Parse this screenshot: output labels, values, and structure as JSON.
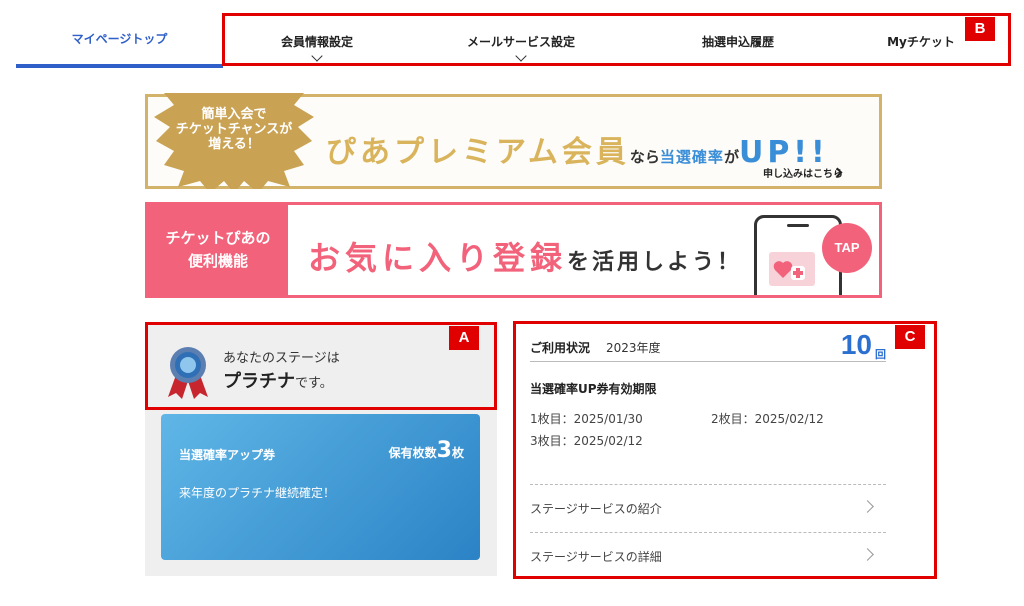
{
  "nav": {
    "home": "マイページトップ",
    "items": [
      {
        "label": "会員情報設定"
      },
      {
        "label": "メールサービス設定"
      },
      {
        "label": "抽選申込履歴"
      },
      {
        "label": "Myチケット"
      }
    ],
    "tag": "B"
  },
  "banner1": {
    "badge": "簡単入会で\nチケットチャンスが\n増える！",
    "main": "ぴあプレミアム会員",
    "nara": "なら",
    "highlight": "当選確率",
    "ga": "が",
    "up": "UP!!",
    "link": "申し込みはこちら"
  },
  "banner2": {
    "left_line1": "チケットぴあの",
    "left_line2": "便利機能",
    "main": "お気に入り登録",
    "rest": "を活用しよう！",
    "tap": "TAP"
  },
  "stage": {
    "tag": "A",
    "prefix": "あなたのステージは",
    "name": "プラチナ",
    "suffix": "です。"
  },
  "ticket": {
    "title": "当選確率アップ券",
    "count_label": "保有枚数",
    "count": "3",
    "count_unit": "枚",
    "message": "来年度のプラチナ継続確定！"
  },
  "usage": {
    "tag": "C",
    "title": "ご利用状況",
    "year": "2023年度",
    "count": "10",
    "unit": "回",
    "subtitle": "当選確率UP券有効期限",
    "dates": [
      "1枚目：2025/01/30",
      "2枚目：2025/02/12",
      "3枚目：2025/02/12"
    ],
    "links": [
      "ステージサービスの紹介",
      "ステージサービスの詳細"
    ]
  },
  "colors": {
    "nav_accent": "#2f5fc8",
    "annotation_red": "#e00000",
    "gold": "#d3b26a",
    "pink": "#f2627a",
    "blue": "#2b83c6"
  }
}
